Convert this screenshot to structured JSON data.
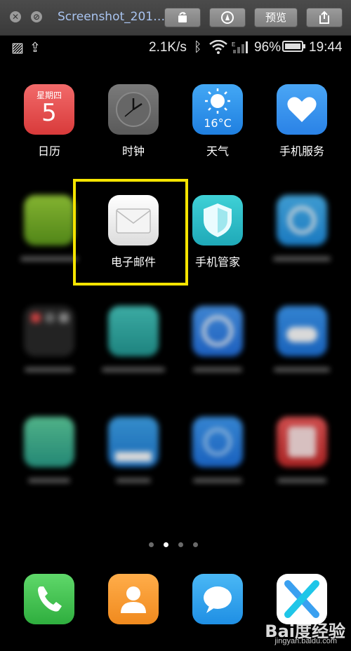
{
  "window": {
    "title": "Screenshot_201…",
    "preview_label": "预览"
  },
  "status_bar": {
    "speed": "2.1K/s",
    "battery": "96%",
    "time": "19:44"
  },
  "apps": {
    "calendar": {
      "label": "日历",
      "weekday": "星期四",
      "day": "5"
    },
    "clock": {
      "label": "时钟"
    },
    "weather": {
      "label": "天气",
      "temp": "16°C"
    },
    "service": {
      "label": "手机服务"
    },
    "email": {
      "label": "电子邮件"
    },
    "manager": {
      "label": "手机管家"
    }
  },
  "watermark": {
    "brand": "Bai度经验",
    "url": "jingyan.baidu.com"
  },
  "pager": {
    "pages": 4,
    "active": 2
  }
}
